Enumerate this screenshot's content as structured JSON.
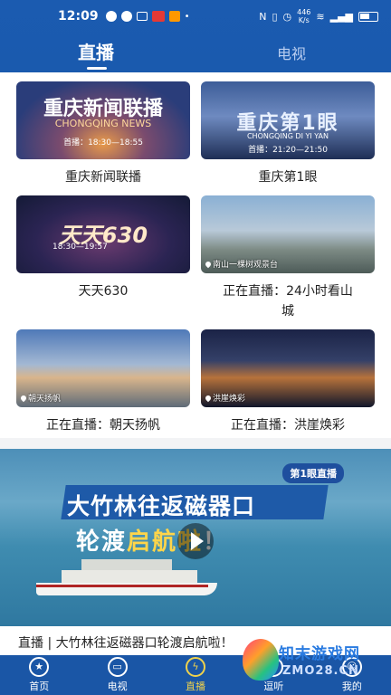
{
  "status_bar": {
    "time": "12:09",
    "net_speed": "446\nK/s",
    "battery": "66"
  },
  "header": {
    "tab_live": "直播",
    "tab_tv": "电视"
  },
  "channels": [
    {
      "brand": "重庆新闻联播",
      "sub": "CHONGQING NEWS",
      "airtime": "首播：18:30—18:55",
      "caption": "重庆新闻联播",
      "location": ""
    },
    {
      "brand": "重庆第1眼",
      "sub": "CHONGQING DI YI YAN",
      "airtime": "首播：21:20—21:50",
      "caption": "重庆第1眼",
      "location": ""
    },
    {
      "brand": "天天630",
      "sub": "",
      "airtime": "18:30—19:57",
      "caption": "天天630",
      "location": ""
    },
    {
      "brand": "",
      "sub": "",
      "airtime": "",
      "caption": "正在直播：24小时看山城",
      "location": "南山一棵树观景台"
    },
    {
      "brand": "",
      "sub": "",
      "airtime": "",
      "caption": "正在直播：朝天扬帆",
      "location": "朝天扬帆"
    },
    {
      "brand": "",
      "sub": "",
      "airtime": "",
      "caption": "正在直播：洪崖焕彩",
      "location": "洪崖焕彩"
    }
  ],
  "banner": {
    "tag": "第1眼直播",
    "line1": "大竹林往返磁器口",
    "line2_a": "轮渡",
    "line2_b": "启航啦",
    "line2_c": "！",
    "caption": "直播 | 大竹林往返磁器口轮渡启航啦！"
  },
  "nav": [
    {
      "label": "首页",
      "icon": "★"
    },
    {
      "label": "电视",
      "icon": "▭"
    },
    {
      "label": "直播",
      "icon": "ϟ"
    },
    {
      "label": "逗听",
      "icon": "◉"
    },
    {
      "label": "我的",
      "icon": "☺"
    }
  ],
  "watermark": {
    "text": "知末游戏网",
    "url": "ZMO28.CN"
  },
  "colors": {
    "header_blue": "#1b5bb0",
    "nav_blue": "#1a56a6",
    "active_yellow": "#f0d24c"
  }
}
